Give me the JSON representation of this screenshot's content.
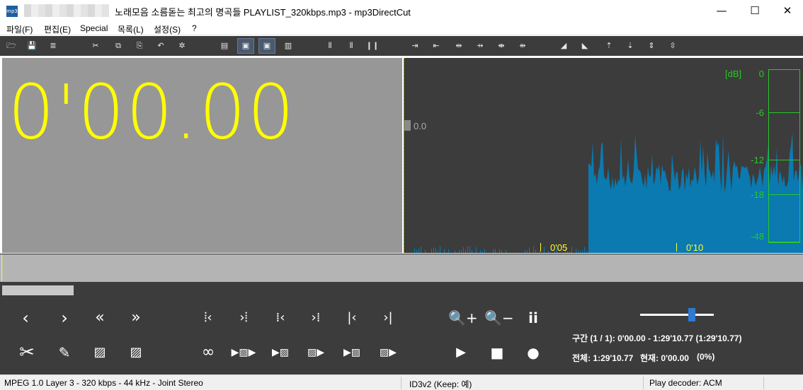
{
  "window": {
    "app_icon_label": "mp3",
    "title": "노래모음  소름돋는 최고의 명곡들 PLAYLIST_320kbps.mp3 - mp3DirectCut",
    "minimize": "—",
    "maximize": "☐",
    "close": "✕"
  },
  "menu": [
    "파일(F)",
    "편집(E)",
    "Special",
    "목록(L)",
    "설정(S)",
    "?"
  ],
  "display": {
    "time": "0'00.00",
    "level_value": "0.0",
    "db_unit": "[dB]",
    "db_scale": [
      "0",
      "-6",
      "-12",
      "-18",
      "-48"
    ],
    "time_ticks": [
      "0'05",
      "0'10"
    ]
  },
  "info": {
    "selection": "구간 (1 / 1): 0'00.00 - 1:29'10.77 (1:29'10.77)",
    "total_label": "전체: 1:29'10.77",
    "current_label": "현재: 0'00.00",
    "percent": "(0%)",
    "volume_fraction": 0.7
  },
  "status": {
    "format": "MPEG 1.0 Layer 3  -  320 kbps  -  44 kHz  -  Joint Stereo",
    "tag": "ID3v2 (Keep: 예)",
    "decoder": "Play decoder: ACM"
  },
  "colors": {
    "waveform": "#0a7ab0",
    "time_text": "#ffff00",
    "db_text": "#28c828",
    "panel_bg": "#3c3c3c"
  }
}
